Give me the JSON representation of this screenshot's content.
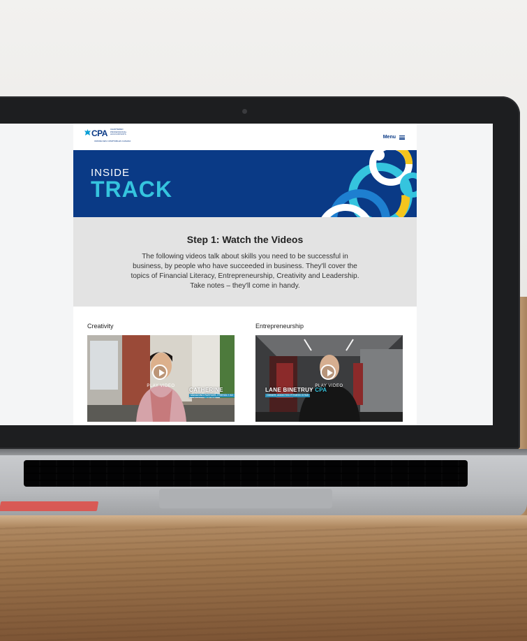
{
  "brand": {
    "logo_mark": "CPA",
    "logo_text": "CHARTERED PROFESSIONAL ACCOUNTANTS",
    "logo_sub": "ORDRE DES COMPTABLES CANADA",
    "colors": {
      "navy": "#0a3a86",
      "teal": "#35c4de",
      "yellow": "#f3c51d",
      "white": "#ffffff",
      "intro_bg": "#e3e3e3"
    }
  },
  "nav": {
    "menu_label": "Menu",
    "menu_icon": "hamburger-icon"
  },
  "hero": {
    "line1": "INSIDE",
    "line2": "TRACK"
  },
  "intro": {
    "title": "Step 1: Watch the Videos",
    "body": "The following videos talk about skills you need to be successful in business, by people who have succeeded in business. They'll cover the topics of Financial Literacy, Entrepreneurship, Creativity and Leadership. Take notes – they'll come in handy."
  },
  "videos": [
    {
      "label": "Creativity",
      "play_label": "PLAY VIDEO",
      "presenter_name": "CATHERINE LAM",
      "presenter_tag": "CPA",
      "presenter_title": "MANAGING PARTNER, FRIENDLY AD"
    },
    {
      "label": "Entrepreneurship",
      "play_label": "PLAY VIDEO",
      "presenter_name": "LANE BINETRUY",
      "presenter_tag": "CPA",
      "presenter_title": "OWNER, ADDICTED FITNESS GYMS"
    }
  ],
  "photo": {
    "sticker_text": ""
  }
}
